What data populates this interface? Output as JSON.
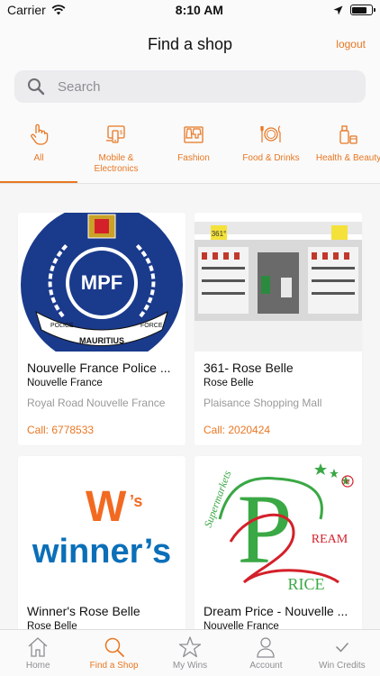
{
  "status_bar": {
    "carrier": "Carrier",
    "time": "8:10 AM"
  },
  "header": {
    "title": "Find a shop",
    "logout_label": "logout"
  },
  "search": {
    "placeholder": "Search"
  },
  "categories": [
    {
      "label": "All",
      "icon": "hand-pointer-icon",
      "active": true
    },
    {
      "label": "Mobile & Electronics",
      "icon": "mobile-icon"
    },
    {
      "label": "Fashion",
      "icon": "clothes-rack-icon"
    },
    {
      "label": "Food & Drinks",
      "icon": "cutlery-plate-icon"
    },
    {
      "label": "Health & Beauty",
      "icon": "cosmetics-icon"
    }
  ],
  "shops": [
    {
      "name": "Nouvelle France Police ...",
      "area": "Nouvelle France",
      "address": "Royal Road Nouvelle France",
      "call": "Call: 6778533",
      "logo_text": "MPF"
    },
    {
      "name": "361- Rose Belle",
      "area": "Rose Belle",
      "address": "Plaisance Shopping Mall",
      "call": "Call: 2020424",
      "logo_text": "361°"
    },
    {
      "name": "Winner's Rose Belle",
      "area": "Rose Belle",
      "address": "",
      "call": "",
      "logo_text": "W's winner's"
    },
    {
      "name": "Dream Price - Nouvelle ...",
      "area": "Nouvelle France",
      "address": "",
      "call": "",
      "logo_text": "Dream Price"
    }
  ],
  "tabs": [
    {
      "label": "Home",
      "icon": "home-icon"
    },
    {
      "label": "Find a Shop",
      "icon": "search-icon",
      "active": true
    },
    {
      "label": "My Wins",
      "icon": "star-icon"
    },
    {
      "label": "Account",
      "icon": "person-icon"
    },
    {
      "label": "Win Credits",
      "icon": "checkmark-icon"
    }
  ],
  "colors": {
    "accent": "#e87722",
    "mpf_blue": "#1a3a8c",
    "winners_orange": "#f26a21",
    "winners_blue": "#0b6fb8",
    "dream_green": "#3aa845",
    "dream_red": "#d4202a"
  }
}
